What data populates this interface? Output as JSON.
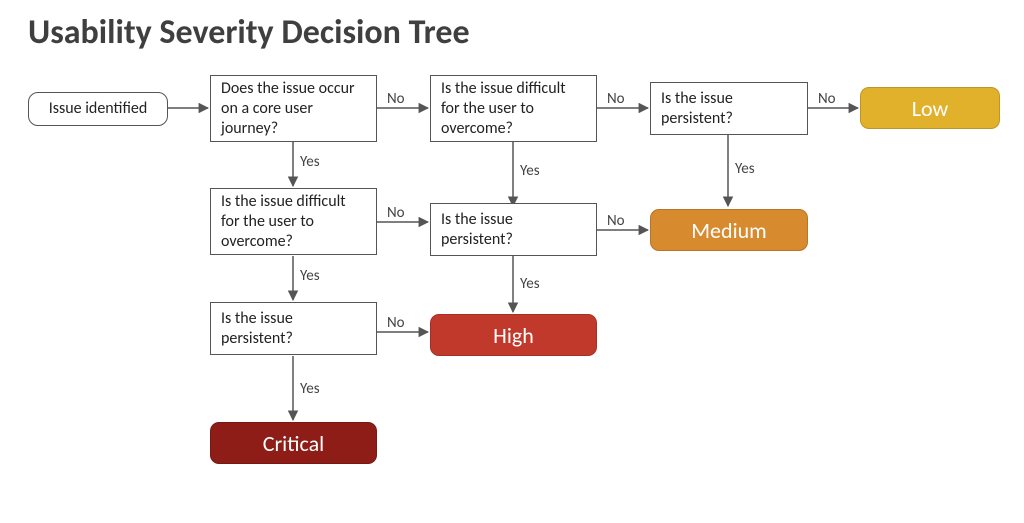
{
  "title": "Usability Severity Decision Tree",
  "labels": {
    "yes": "Yes",
    "no": "No"
  },
  "nodes": {
    "start": "Issue identified",
    "q_core": "Does the issue occur on a core user journey?",
    "q_diff_top": "Is the issue difficult for the user to overcome?",
    "q_persist_top": "Is the issue persistent?",
    "q_diff_left": "Is the issue difficult for the user to overcome?",
    "q_persist_mid": "Is the issue persistent?",
    "q_persist_left": "Is the issue persistent?"
  },
  "results": {
    "low": {
      "label": "Low",
      "color": "#e1b12c"
    },
    "medium": {
      "label": "Medium",
      "color": "#d78a2e"
    },
    "high": {
      "label": "High",
      "color": "#c0392b"
    },
    "critical": {
      "label": "Critical",
      "color": "#8e1c17"
    }
  },
  "chart_data": {
    "type": "decision-tree",
    "title": "Usability Severity Decision Tree",
    "root": "start",
    "nodes": [
      {
        "id": "start",
        "kind": "start",
        "text": "Issue identified"
      },
      {
        "id": "q_core",
        "kind": "decision",
        "text": "Does the issue occur on a core user journey?"
      },
      {
        "id": "q_diff_top",
        "kind": "decision",
        "text": "Is the issue difficult for the user to overcome?"
      },
      {
        "id": "q_persist_top",
        "kind": "decision",
        "text": "Is the issue persistent?"
      },
      {
        "id": "q_diff_left",
        "kind": "decision",
        "text": "Is the issue difficult for the user to overcome?"
      },
      {
        "id": "q_persist_mid",
        "kind": "decision",
        "text": "Is the issue persistent?"
      },
      {
        "id": "q_persist_left",
        "kind": "decision",
        "text": "Is the issue persistent?"
      },
      {
        "id": "low",
        "kind": "result",
        "text": "Low",
        "color": "#e1b12c"
      },
      {
        "id": "medium",
        "kind": "result",
        "text": "Medium",
        "color": "#d78a2e"
      },
      {
        "id": "high",
        "kind": "result",
        "text": "High",
        "color": "#c0392b"
      },
      {
        "id": "critical",
        "kind": "result",
        "text": "Critical",
        "color": "#8e1c17"
      }
    ],
    "edges": [
      {
        "from": "start",
        "to": "q_core",
        "label": ""
      },
      {
        "from": "q_core",
        "to": "q_diff_left",
        "label": "Yes"
      },
      {
        "from": "q_core",
        "to": "q_diff_top",
        "label": "No"
      },
      {
        "from": "q_diff_top",
        "to": "q_persist_mid",
        "label": "Yes"
      },
      {
        "from": "q_diff_top",
        "to": "q_persist_top",
        "label": "No"
      },
      {
        "from": "q_persist_top",
        "to": "medium",
        "label": "Yes"
      },
      {
        "from": "q_persist_top",
        "to": "low",
        "label": "No"
      },
      {
        "from": "q_diff_left",
        "to": "q_persist_left",
        "label": "Yes"
      },
      {
        "from": "q_diff_left",
        "to": "q_persist_mid",
        "label": "No"
      },
      {
        "from": "q_persist_mid",
        "to": "high",
        "label": "Yes"
      },
      {
        "from": "q_persist_mid",
        "to": "medium",
        "label": "No"
      },
      {
        "from": "q_persist_left",
        "to": "critical",
        "label": "Yes"
      },
      {
        "from": "q_persist_left",
        "to": "high",
        "label": "No"
      }
    ]
  }
}
